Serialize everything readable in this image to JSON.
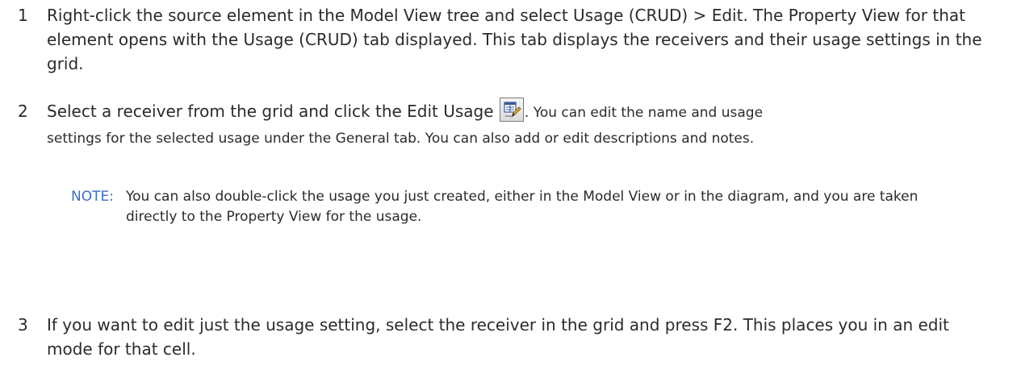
{
  "steps": [
    {
      "number": "1",
      "text": "Right-click the source element in the Model View tree and select Usage (CRUD) > Edit. The Property View for that element opens with the Usage (CRUD) tab displayed. This tab displays the receivers and their usage settings in the grid."
    },
    {
      "number": "2",
      "lead": "Select a receiver from the grid and click the Edit Usage",
      "icon": "edit-usage-icon",
      "after_icon": ". You can edit the name and usage",
      "rest": "settings for the selected usage under the General tab. You can also add or edit descriptions and notes."
    },
    {
      "number": "3",
      "text": "If you want to edit just the usage setting, select the receiver in the grid and press F2. This places you in an edit mode for that cell."
    }
  ],
  "note": {
    "label": "NOTE:",
    "text": "You can also double-click the usage you just created, either in the Model View or in the diagram, and you are taken directly to the Property View for the usage."
  },
  "colors": {
    "note_label": "#3b6fc4",
    "body_text": "#2b2b2b"
  }
}
